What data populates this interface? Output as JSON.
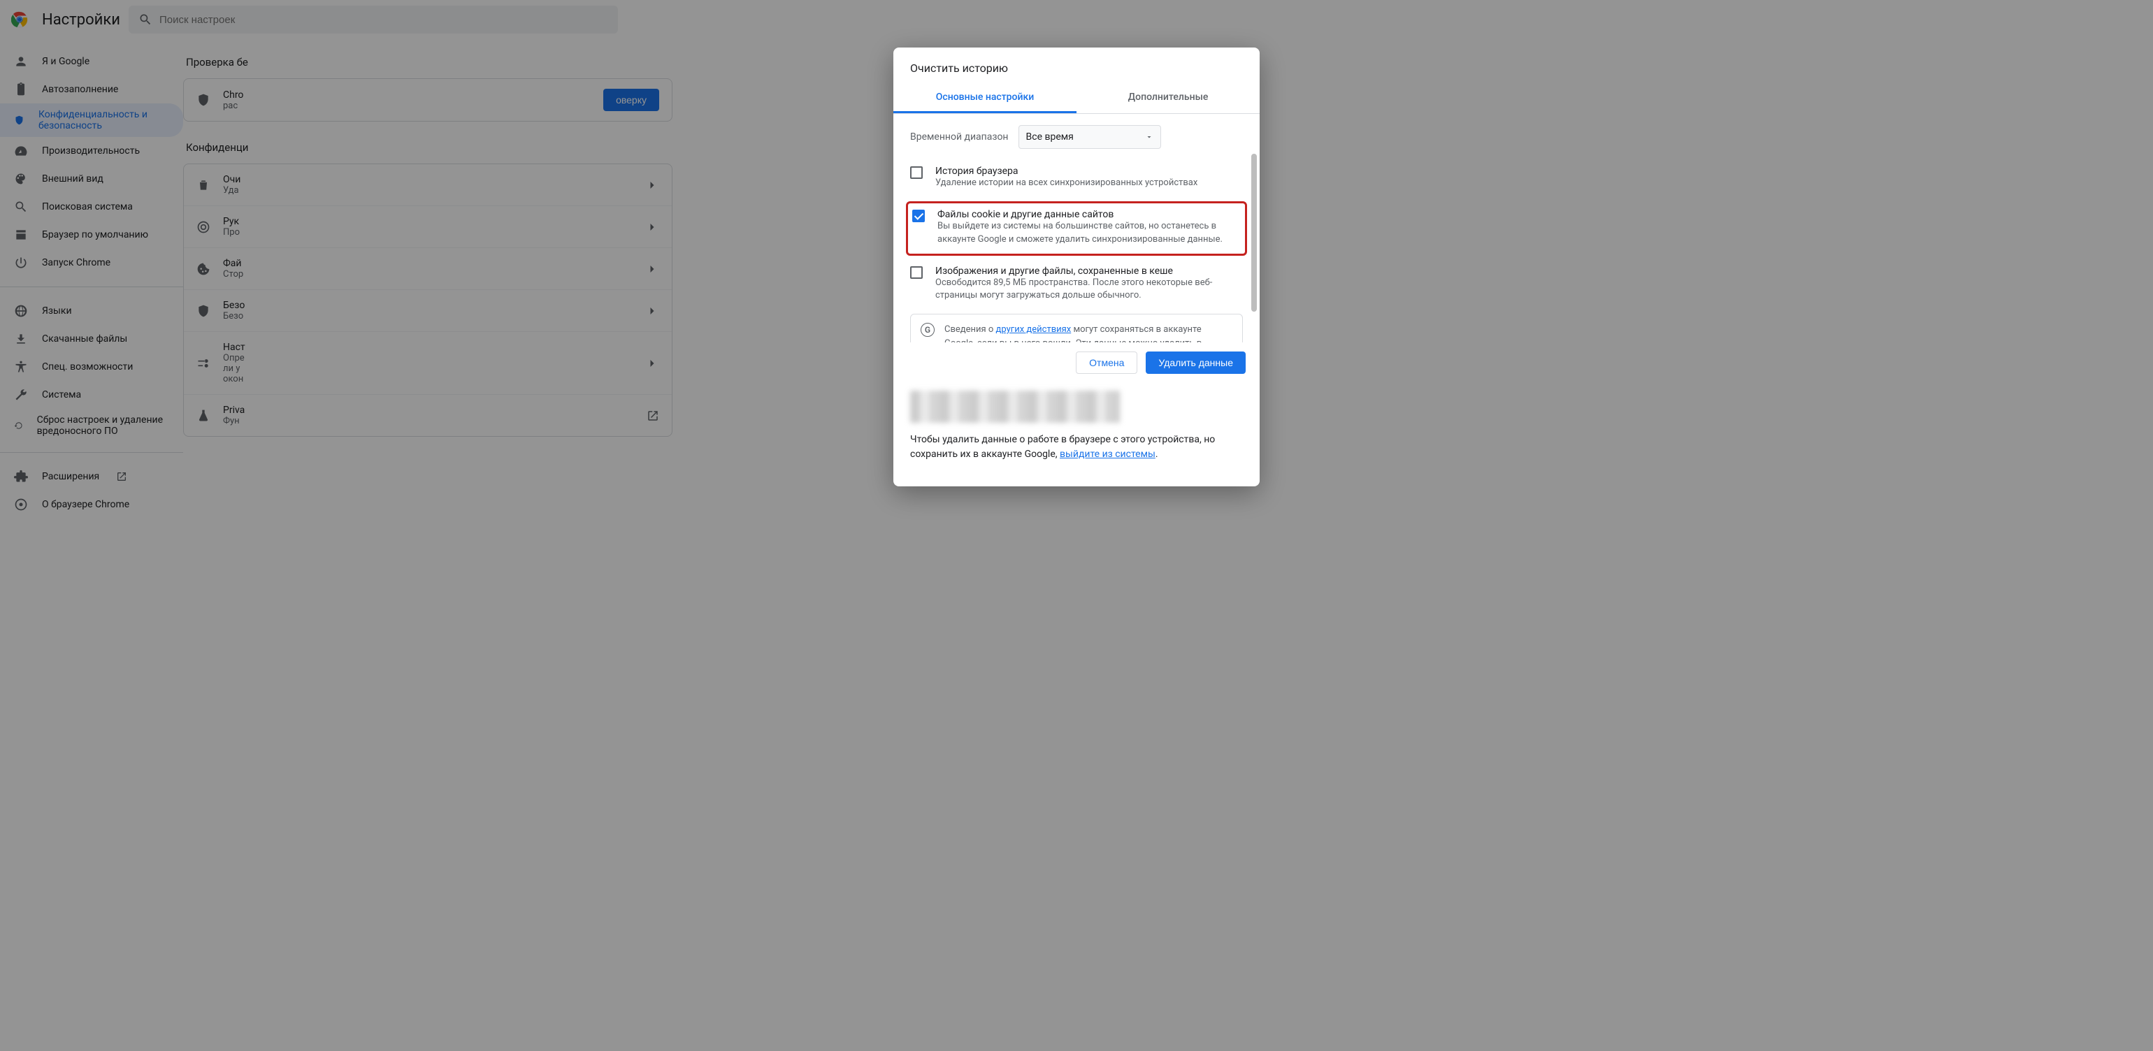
{
  "header": {
    "title": "Настройки",
    "search_placeholder": "Поиск настроек"
  },
  "sidebar": {
    "items": [
      {
        "label": "Я и Google"
      },
      {
        "label": "Автозаполнение"
      },
      {
        "label": "Конфиденциальность и безопасность"
      },
      {
        "label": "Производительность"
      },
      {
        "label": "Внешний вид"
      },
      {
        "label": "Поисковая система"
      },
      {
        "label": "Браузер по умолчанию"
      },
      {
        "label": "Запуск Chrome"
      }
    ],
    "items2": [
      {
        "label": "Языки"
      },
      {
        "label": "Скачанные файлы"
      },
      {
        "label": "Спец. возможности"
      },
      {
        "label": "Система"
      },
      {
        "label": "Сброс настроек и удаление вредоносного ПО"
      }
    ],
    "items3": [
      {
        "label": "Расширения"
      },
      {
        "label": "О браузере Chrome"
      }
    ]
  },
  "main": {
    "section_check_title": "Проверка бе",
    "check_line1": "Chro",
    "check_line2": "рас",
    "check_button": "оверку",
    "section_privacy_title": "Конфиденци",
    "rows": [
      {
        "t": "Очи",
        "s": "Уда"
      },
      {
        "t": "Рук",
        "s": "Про"
      },
      {
        "t": "Фай",
        "s": "Стор"
      },
      {
        "t": "Безо",
        "s": "Безо"
      },
      {
        "t": "Наст",
        "s": "Опре",
        "s2": "ли у",
        "s3": "окон",
        "long": true
      },
      {
        "t": "Priva",
        "s": "Фун"
      }
    ]
  },
  "modal": {
    "title": "Очистить историю",
    "tab_basic": "Основные настройки",
    "tab_adv": "Дополнительные",
    "range_label": "Временной диапазон",
    "range_value": "Все время",
    "opt1_title": "История браузера",
    "opt1_sub": "Удаление истории на всех синхронизированных устройствах",
    "opt2_title": "Файлы cookie и другие данные сайтов",
    "opt2_sub": "Вы выйдете из системы на большинстве сайтов, но останетесь в аккаунте Google и сможете удалить синхронизированные данные.",
    "opt3_title": "Изображения и другие файлы, сохраненные в кеше",
    "opt3_sub": "Освободится 89,5 МБ пространства. После этого некоторые веб-страницы могут загружаться дольше обычного.",
    "info_pre": "Сведения о ",
    "info_link": "других действиях",
    "info_post": " могут сохраняться в аккаунте Google, если вы в него вошли. Эти данные можно удалить в",
    "btn_cancel": "Отмена",
    "btn_delete": "Удалить данные",
    "note_pre": "Чтобы удалить данные о работе в браузере с этого устройства, но сохранить их в аккаунте Google, ",
    "note_link": "выйдите из системы",
    "note_post": "."
  }
}
